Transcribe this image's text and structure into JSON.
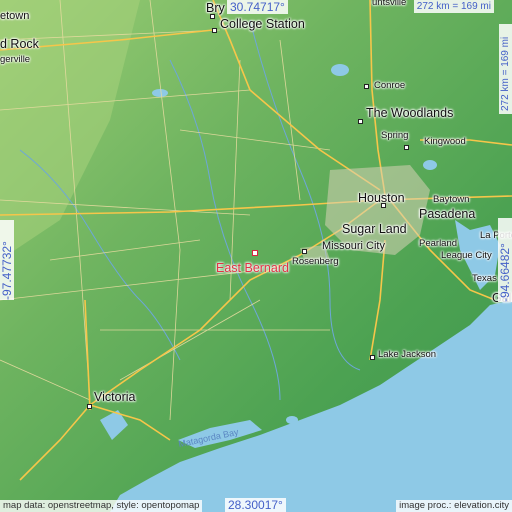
{
  "map": {
    "focus_place": "East Bernard",
    "places": [
      {
        "id": "bryan",
        "name": "Bry",
        "size": "big"
      },
      {
        "id": "college-station",
        "name": "College Station",
        "size": "big"
      },
      {
        "id": "round-rock",
        "name": "d Rock",
        "size": "big"
      },
      {
        "id": "georgetown",
        "name": "etown",
        "size": "sm"
      },
      {
        "id": "pflugerville",
        "name": "gerville",
        "size": "sm"
      },
      {
        "id": "huntsville",
        "name": "untsville",
        "size": "sm"
      },
      {
        "id": "conroe",
        "name": "Conroe",
        "size": "sm"
      },
      {
        "id": "the-woodlands",
        "name": "The Woodlands",
        "size": "big"
      },
      {
        "id": "spring",
        "name": "Spring",
        "size": "sm"
      },
      {
        "id": "kingwood",
        "name": "Kingwood",
        "size": "sm"
      },
      {
        "id": "houston",
        "name": "Houston",
        "size": "big"
      },
      {
        "id": "baytown",
        "name": "Baytown",
        "size": "sm"
      },
      {
        "id": "pasadena",
        "name": "Pasadena",
        "size": "big"
      },
      {
        "id": "sugar-land",
        "name": "Sugar Land",
        "size": "big"
      },
      {
        "id": "missouri-city",
        "name": "Missouri City",
        "size": "normal"
      },
      {
        "id": "pearland",
        "name": "Pearland",
        "size": "sm"
      },
      {
        "id": "la-porte",
        "name": "La Porte",
        "size": "sm"
      },
      {
        "id": "league-city",
        "name": "League City",
        "size": "sm"
      },
      {
        "id": "texas-city",
        "name": "Texas",
        "size": "sm"
      },
      {
        "id": "galveston",
        "name": "Gal",
        "size": "big"
      },
      {
        "id": "rosenberg",
        "name": "Rosenberg",
        "size": "sm"
      },
      {
        "id": "lake-jackson",
        "name": "Lake Jackson",
        "size": "sm"
      },
      {
        "id": "victoria",
        "name": "Victoria",
        "size": "big"
      }
    ],
    "water_labels": [
      {
        "id": "matagorda-bay",
        "name": "Matagorda Bay"
      }
    ]
  },
  "coords": {
    "top_lat": "30.74717°",
    "bottom_lat": "28.30017°",
    "left_lon": "-97.47732°",
    "right_lon": "-94.66482°"
  },
  "scale": {
    "horizontal": "272 km = 169 mi",
    "vertical": "272 km = 169 mi"
  },
  "credits": {
    "left": "map data: openstreetmap, style: opentopomap",
    "right": "image proc.: elevation.city"
  },
  "colors": {
    "land_low": "#3f9c4e",
    "land_high": "#8cc46c",
    "sea": "#8ec9e6",
    "marker": "#e23246",
    "coord_text": "#4460c8"
  }
}
